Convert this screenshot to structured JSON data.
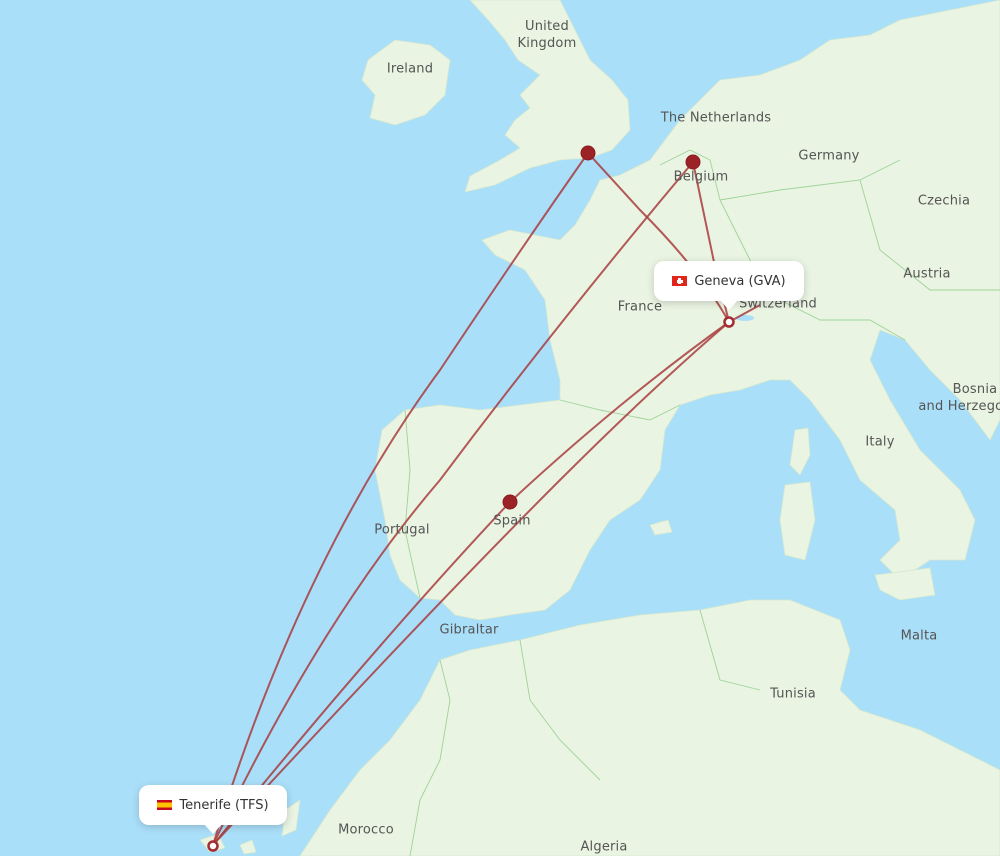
{
  "map": {
    "colors": {
      "sea": "#aadff9",
      "land": "#eaf4e2",
      "route": "#a83c3e",
      "stop": "#9b2226"
    },
    "labels": [
      {
        "id": "united-kingdom",
        "text": "United\nKingdom"
      },
      {
        "id": "ireland",
        "text": "Ireland"
      },
      {
        "id": "the-netherlands",
        "text": "The Netherlands"
      },
      {
        "id": "germany",
        "text": "Germany"
      },
      {
        "id": "belgium",
        "text": "Belgium"
      },
      {
        "id": "czechia",
        "text": "Czechia"
      },
      {
        "id": "austria",
        "text": "Austria"
      },
      {
        "id": "france",
        "text": "France"
      },
      {
        "id": "switzerland",
        "text": "Switzerland"
      },
      {
        "id": "italy",
        "text": "Italy"
      },
      {
        "id": "bosnia",
        "text": "Bosnia\nand Herzegovina"
      },
      {
        "id": "portugal",
        "text": "Portugal"
      },
      {
        "id": "spain",
        "text": "Spain"
      },
      {
        "id": "gibraltar",
        "text": "Gibraltar"
      },
      {
        "id": "malta",
        "text": "Malta"
      },
      {
        "id": "tunisia",
        "text": "Tunisia"
      },
      {
        "id": "morocco",
        "text": "Morocco"
      },
      {
        "id": "algeria",
        "text": "Algeria"
      }
    ],
    "origin": {
      "name": "Geneva (GVA)",
      "flag": "switzerland-flag"
    },
    "destination": {
      "name": "Tenerife (TFS)",
      "flag": "spain-flag"
    },
    "stops": [
      {
        "id": "london",
        "name": "London"
      },
      {
        "id": "brussels",
        "name": "Brussels"
      },
      {
        "id": "madrid",
        "name": "Madrid"
      }
    ],
    "routes": [
      {
        "from": "Tenerife (TFS)",
        "via": "London",
        "to": "Geneva (GVA)"
      },
      {
        "from": "Tenerife (TFS)",
        "via": "Brussels",
        "to": "Geneva (GVA)"
      },
      {
        "from": "Tenerife (TFS)",
        "via": "Madrid",
        "to": "Geneva (GVA)"
      },
      {
        "from": "Tenerife (TFS)",
        "via": null,
        "to": "Geneva (GVA)"
      }
    ]
  }
}
